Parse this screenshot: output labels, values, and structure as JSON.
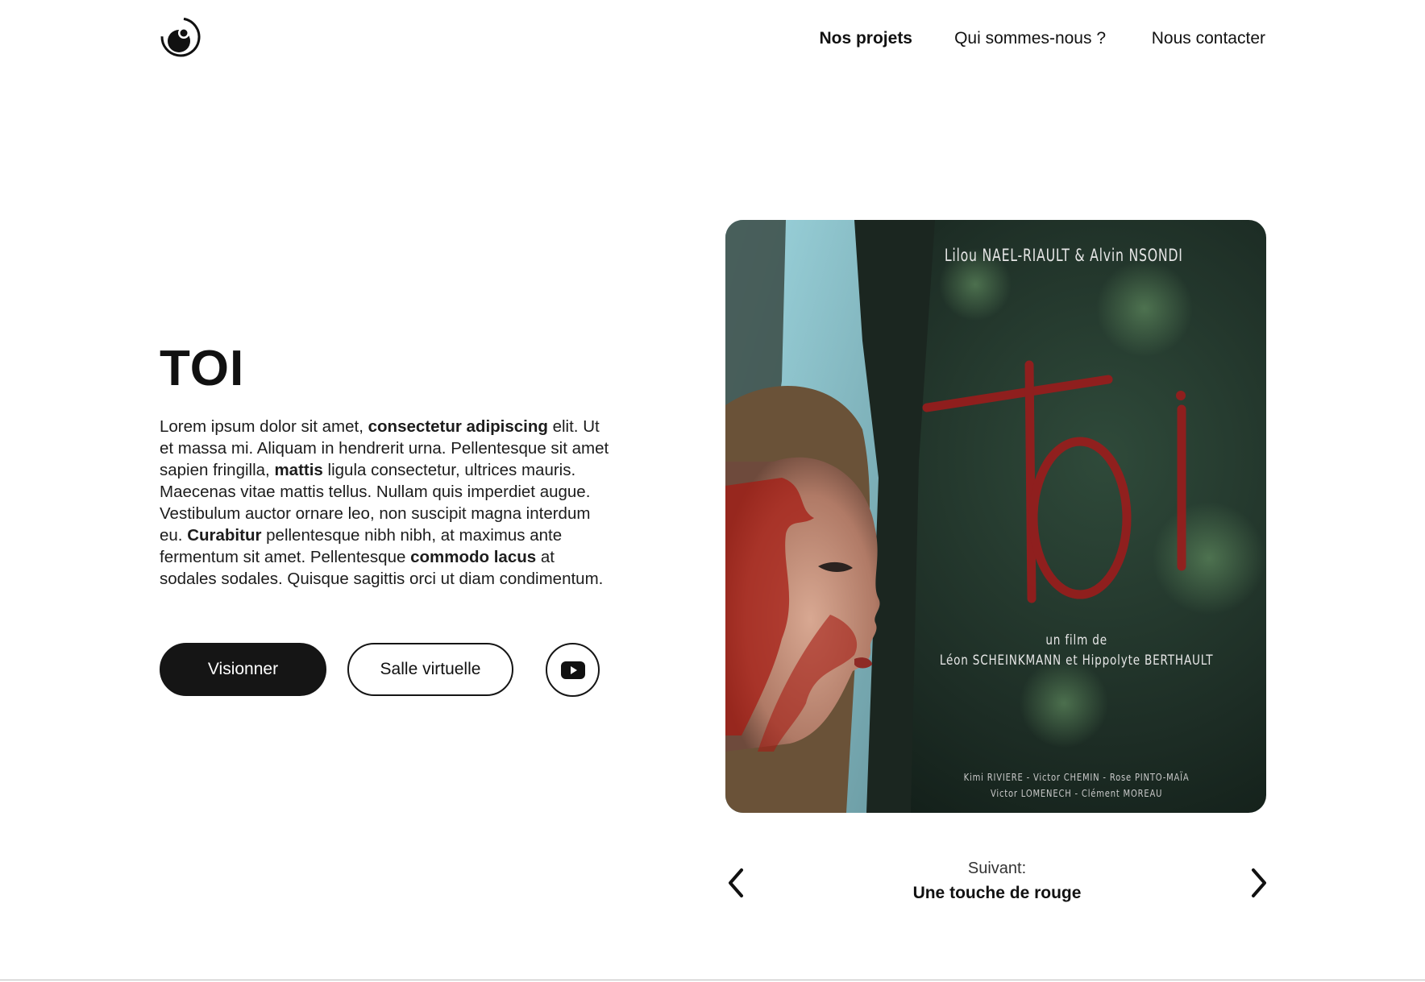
{
  "header": {
    "logo_icon": "logo-icon",
    "nav": {
      "projects": "Nos projets",
      "about": "Qui sommes-nous ?",
      "contact": "Nous contacter"
    }
  },
  "project": {
    "title": "TOI",
    "description_parts": {
      "p1": "Lorem ipsum dolor sit amet, ",
      "b1": "consectetur adipiscing",
      "p2": " elit. Ut et massa mi. Aliquam in hendrerit urna. Pellentesque sit amet sapien fringilla, ",
      "b2": "mattis",
      "p3": " ligula consectetur, ultrices mauris. Maecenas vitae mattis tellus. Nullam quis imperdiet augue. Vestibulum auctor ornare leo, non suscipit magna interdum eu. ",
      "b3": "Curabitur",
      "p4": " pellentesque nibh nibh, at maximus ante fermentum sit amet. Pellentesque ",
      "b4": "commodo lacus",
      "p5": " at sodales sodales. Quisque sagittis orci ut diam condimentum."
    },
    "buttons": {
      "watch": "Visionner",
      "virtual_room": "Salle virtuelle",
      "youtube_icon": "youtube-icon"
    }
  },
  "poster": {
    "actors": "Lilou NAEL-RIAULT   &   Alvin NSONDI",
    "title": "Toi",
    "byline_1": "un film de",
    "byline_2": "Léon SCHEINKMANN et Hippolyte BERTHAULT",
    "credits_1": "Kimi RIVIERE - Victor CHEMIN -  Rose PINTO-MAÏA",
    "credits_2": "Victor LOMENECH - Clément MOREAU",
    "colors": {
      "title": "#9b1c1c",
      "background": "#1e2b24"
    }
  },
  "pager": {
    "next_label": "Suivant:",
    "next_title": "Une touche de rouge",
    "prev_icon": "chevron-left-icon",
    "next_icon": "chevron-right-icon"
  }
}
